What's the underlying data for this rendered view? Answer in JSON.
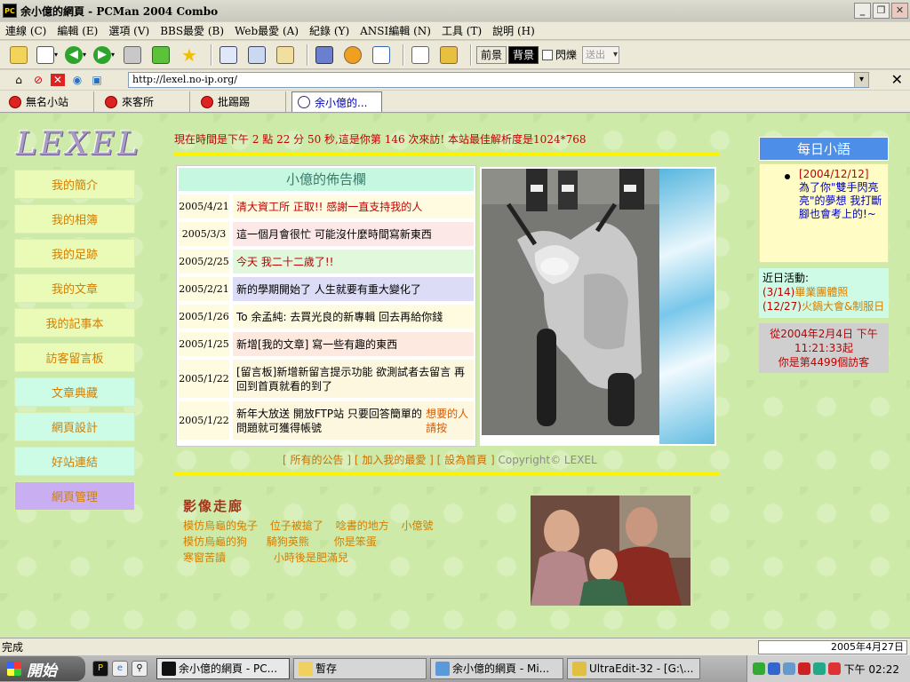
{
  "window": {
    "title": "余小億的網頁 - PCMan 2004 Combo",
    "app_icon_text": "PC"
  },
  "menu": [
    "連線 (C)",
    "編輯 (E)",
    "選項 (V)",
    "BBS最愛 (B)",
    "Web最愛 (A)",
    "紀錄 (Y)",
    "ANSI編輯 (N)",
    "工具 (T)",
    "說明 (H)"
  ],
  "toolbar": {
    "fg_label": "前景",
    "bg_label": "背景",
    "flash_label": "閃爍",
    "send_label": "送出"
  },
  "address": {
    "url": "http://lexel.no-ip.org/"
  },
  "tabs": [
    {
      "label": "無名小站"
    },
    {
      "label": "來客所"
    },
    {
      "label": "批踢踢"
    },
    {
      "label": "余小億的..."
    }
  ],
  "page": {
    "logo": "LEXEL",
    "ticker": "現在時間是下午 2 點 22 分 50 秒,這是你第 146 次來訪! 本站最佳解析度是1024*768",
    "nav": [
      "我的簡介",
      "我的相簿",
      "我的足跡",
      "我的文章",
      "我的記事本",
      "訪客留言板",
      "文章典藏",
      "網頁設計",
      "好站連結",
      "網頁管理"
    ],
    "board_title": "小億的佈告欄",
    "notices": [
      {
        "date": "2005/4/21",
        "text": "清大資工所 正取!! 感謝一直支持我的人"
      },
      {
        "date": "2005/3/3",
        "text": "這一個月會很忙 可能沒什麼時間寫新東西"
      },
      {
        "date": "2005/2/25",
        "text": "今天 我二十二歲了!!"
      },
      {
        "date": "2005/2/21",
        "text": "新的學期開始了 人生就要有重大變化了"
      },
      {
        "date": "2005/1/26",
        "text": "To 余孟純: 去買光良的新專輯 回去再給你錢"
      },
      {
        "date": "2005/1/25",
        "text": "新增[我的文章] 寫一些有趣的東西"
      },
      {
        "date": "2005/1/22",
        "text": "[留言板]新增新留言提示功能 欲測試者去留言 再回到首頁就看的到了"
      },
      {
        "date": "2005/1/22",
        "text": "新年大放送 開放FTP站 只要回答簡單的問題就可獲得帳號 ",
        "highlight": "想要的人請按"
      }
    ],
    "footer_links": [
      "所有的公告",
      "加入我的最愛",
      "設為首頁"
    ],
    "copyright": "Copyright© LEXEL",
    "gallery_title": "影像走廊",
    "gallery_rows": [
      [
        "模仿烏龜的兔子",
        "位子被搶了",
        "唸書的地方",
        "小億號"
      ],
      [
        "模仿烏龜的狗",
        "騎狗英熊",
        "你是笨蛋"
      ],
      [
        "寒窗苦讀",
        "小時後是肥滿兒"
      ]
    ],
    "daily_title": "每日小語",
    "daily_date": "[2004/12/12]",
    "daily_text": "為了你\"雙手閃亮亮\"的夢想 我打斷腳也會考上的!~",
    "recent_label": "近日活動:",
    "events": [
      {
        "date": "(3/14)",
        "text": "畢業團體照"
      },
      {
        "date": "(12/27)",
        "text": "火鍋大會&制服日"
      }
    ],
    "visit_text_1": "從2004年2月4日 下午",
    "visit_text_2": "11:21:33起",
    "visit_text_3": "你是第4499個訪客"
  },
  "status": {
    "text": "完成",
    "date": "2005年4月27日"
  },
  "taskbar": {
    "start_label": "開始",
    "tasks": [
      {
        "label": "余小億的網頁 - PC..."
      },
      {
        "label": "暫存"
      },
      {
        "label": "余小億的網頁 - Mi..."
      },
      {
        "label": "UltraEdit-32 - [G:\\..."
      }
    ],
    "clock": "下午 02:22"
  }
}
